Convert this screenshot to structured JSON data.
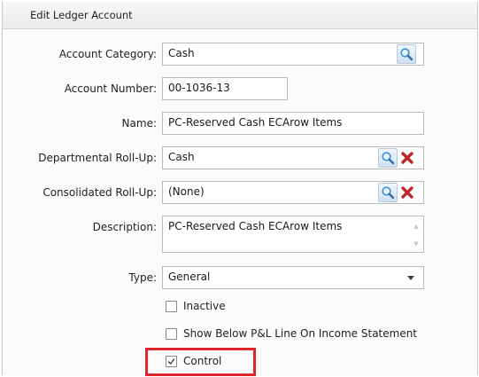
{
  "panel": {
    "title": "Edit Ledger Account"
  },
  "form": {
    "account_category": {
      "label": "Account Category:",
      "value": "Cash"
    },
    "account_number": {
      "label": "Account Number:",
      "value": "00-1036-13"
    },
    "name": {
      "label": "Name:",
      "value": "PC-Reserved Cash ECArow Items"
    },
    "departmental_rollup": {
      "label": "Departmental Roll-Up:",
      "value": "Cash"
    },
    "consolidated_rollup": {
      "label": "Consolidated Roll-Up:",
      "value": "(None)"
    },
    "description": {
      "label": "Description:",
      "value": "PC-Reserved Cash ECArow Items"
    },
    "type": {
      "label": "Type:",
      "value": "General"
    }
  },
  "checkboxes": {
    "inactive": {
      "label": "Inactive",
      "checked": false
    },
    "show_below": {
      "label": "Show Below P&L Line On Income Statement",
      "checked": false
    },
    "control": {
      "label": "Control",
      "checked": true
    }
  },
  "icons": {
    "lookup": "magnifier-icon",
    "clear": "red-x-icon",
    "dropdown": "chevron-down-icon"
  },
  "colors": {
    "highlight": "#e0262b",
    "delete_red": "#c0262b",
    "lookup_blue": "#cfe0f2"
  }
}
